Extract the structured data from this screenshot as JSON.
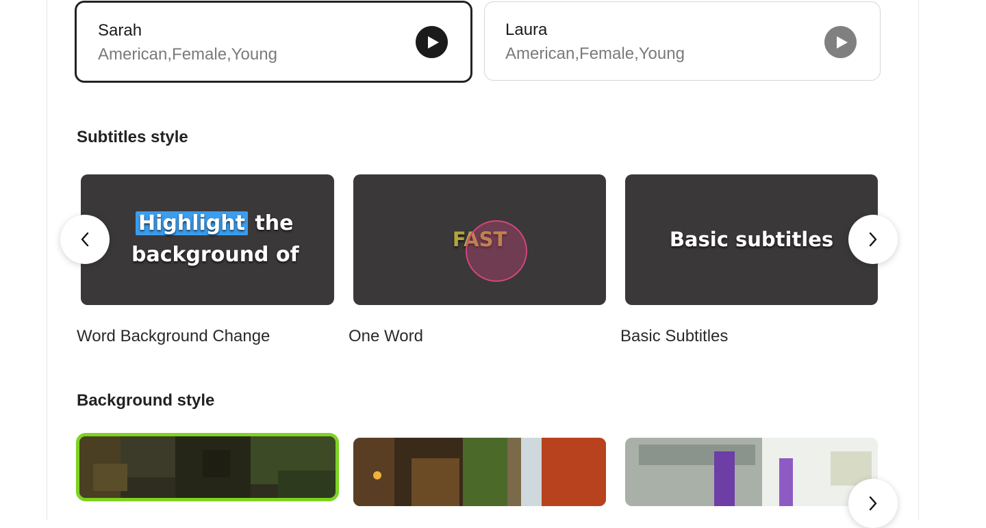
{
  "voices": [
    {
      "name": "Sarah",
      "description": "American,Female,Young",
      "selected": true
    },
    {
      "name": "Laura",
      "description": "American,Female,Young",
      "selected": false
    }
  ],
  "subtitles": {
    "title": "Subtitles style",
    "styles": [
      {
        "label": "Word Background Change",
        "preview_highlight": "Highlight",
        "preview_rest_line1": " the",
        "preview_line2": "background of"
      },
      {
        "label": "One Word",
        "preview": "FAST"
      },
      {
        "label": "Basic Subtitles",
        "preview": "Basic subtitles"
      }
    ]
  },
  "background": {
    "title": "Background style"
  },
  "icons": {
    "play": "play-icon",
    "prev": "chevron-left-icon",
    "next": "chevron-right-icon"
  },
  "colors": {
    "selected_border": "#222222",
    "highlight": "#3b9ded",
    "fast_text": "#b3a43c",
    "cursor_ring": "#d4457d",
    "background_selected": "#7ed321"
  }
}
